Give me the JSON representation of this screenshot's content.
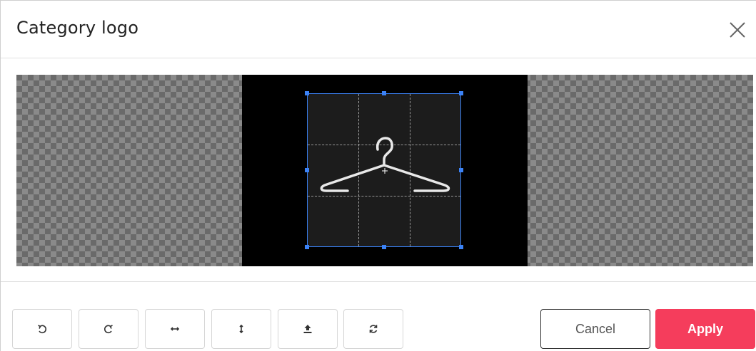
{
  "dialog": {
    "title": "Category logo",
    "close_icon": "close-icon"
  },
  "editor": {
    "image_icon": "clothes-hanger-icon",
    "crop_guides": true,
    "background": "transparency-checkerboard"
  },
  "toolbar": {
    "tools": [
      {
        "name": "rotate-left-icon"
      },
      {
        "name": "rotate-right-icon"
      },
      {
        "name": "flip-horizontal-icon"
      },
      {
        "name": "flip-vertical-icon"
      },
      {
        "name": "upload-icon"
      },
      {
        "name": "reset-icon"
      }
    ]
  },
  "actions": {
    "cancel_label": "Cancel",
    "apply_label": "Apply"
  },
  "colors": {
    "accent": "#3b82f6",
    "apply": "#f53d5c"
  }
}
